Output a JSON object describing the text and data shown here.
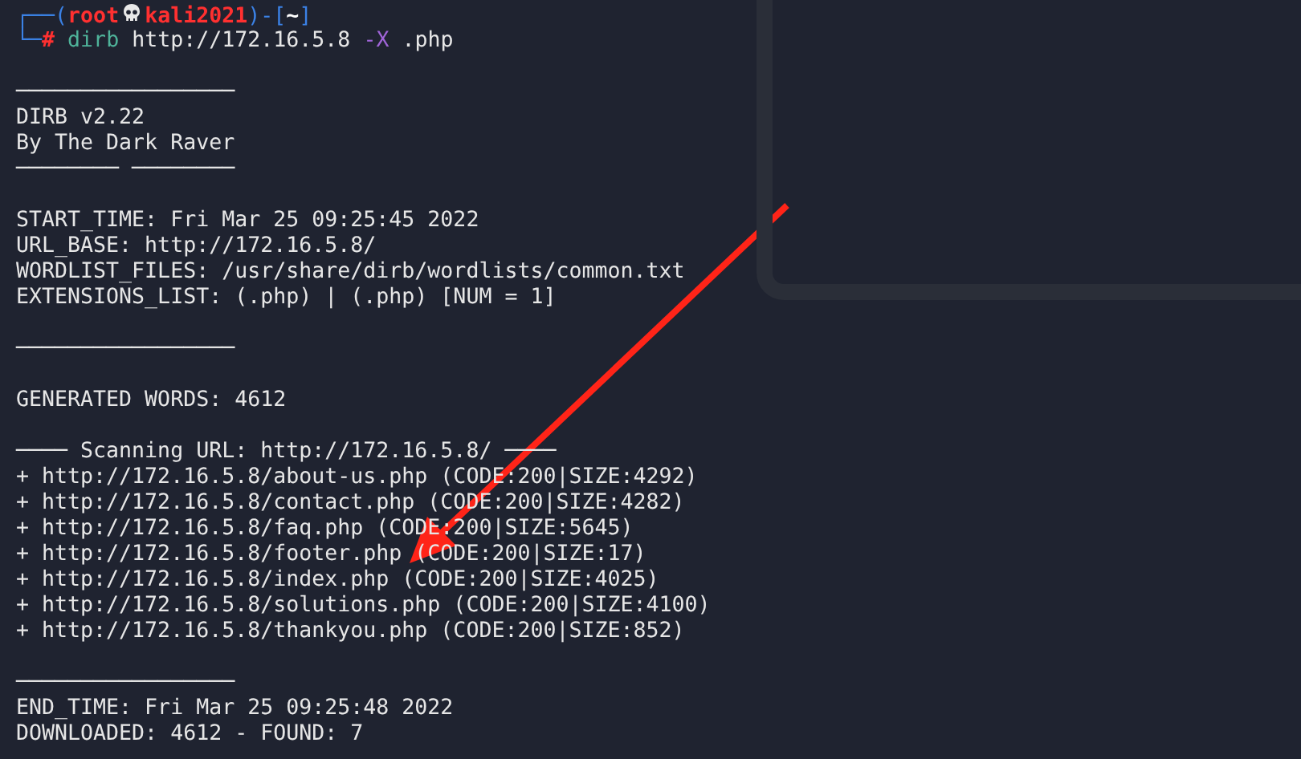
{
  "prompt": {
    "corner_top": "┌──",
    "open": "(",
    "user": "root",
    "host": "kali2021",
    "close": ")-[",
    "cwd": "~",
    "cwd_close": "]",
    "corner_bottom": "└─",
    "symbol": "#",
    "command": [
      {
        "text": "dirb",
        "kind": "program"
      },
      {
        "text": "http://172.16.5.8",
        "kind": "arg"
      },
      {
        "text": "-X",
        "kind": "flag"
      },
      {
        "text": ".php",
        "kind": "arg"
      }
    ]
  },
  "lines": [
    {
      "kind": "blank"
    },
    {
      "kind": "rule",
      "text": "─────────────────"
    },
    {
      "kind": "text",
      "text": "DIRB v2.22"
    },
    {
      "kind": "text",
      "text": "By The Dark Raver"
    },
    {
      "kind": "rule",
      "text": "──────── ────────"
    },
    {
      "kind": "blank"
    },
    {
      "kind": "text",
      "text": "START_TIME: Fri Mar 25 09:25:45 2022"
    },
    {
      "kind": "text",
      "text": "URL_BASE: http://172.16.5.8/"
    },
    {
      "kind": "text",
      "text": "WORDLIST_FILES: /usr/share/dirb/wordlists/common.txt"
    },
    {
      "kind": "text",
      "text": "EXTENSIONS_LIST: (.php) | (.php) [NUM = 1]"
    },
    {
      "kind": "blank"
    },
    {
      "kind": "rule",
      "text": "─────────────────"
    },
    {
      "kind": "blank"
    },
    {
      "kind": "text",
      "text": "GENERATED WORDS: 4612"
    },
    {
      "kind": "blank"
    },
    {
      "kind": "text",
      "text": "──── Scanning URL: http://172.16.5.8/ ────"
    },
    {
      "kind": "result",
      "text": "+ http://172.16.5.8/about-us.php (CODE:200|SIZE:4292)"
    },
    {
      "kind": "result",
      "text": "+ http://172.16.5.8/contact.php (CODE:200|SIZE:4282)"
    },
    {
      "kind": "result",
      "text": "+ http://172.16.5.8/faq.php (CODE:200|SIZE:5645)"
    },
    {
      "kind": "result",
      "text": "+ http://172.16.5.8/footer.php (CODE:200|SIZE:17)"
    },
    {
      "kind": "result",
      "text": "+ http://172.16.5.8/index.php (CODE:200|SIZE:4025)"
    },
    {
      "kind": "result",
      "text": "+ http://172.16.5.8/solutions.php (CODE:200|SIZE:4100)"
    },
    {
      "kind": "result",
      "text": "+ http://172.16.5.8/thankyou.php (CODE:200|SIZE:852)"
    },
    {
      "kind": "blank"
    },
    {
      "kind": "rule",
      "text": "─────────────────"
    },
    {
      "kind": "text",
      "text": "END_TIME: Fri Mar 25 09:25:48 2022"
    },
    {
      "kind": "text",
      "text": "DOWNLOADED: 4612 - FOUND: 7"
    }
  ]
}
